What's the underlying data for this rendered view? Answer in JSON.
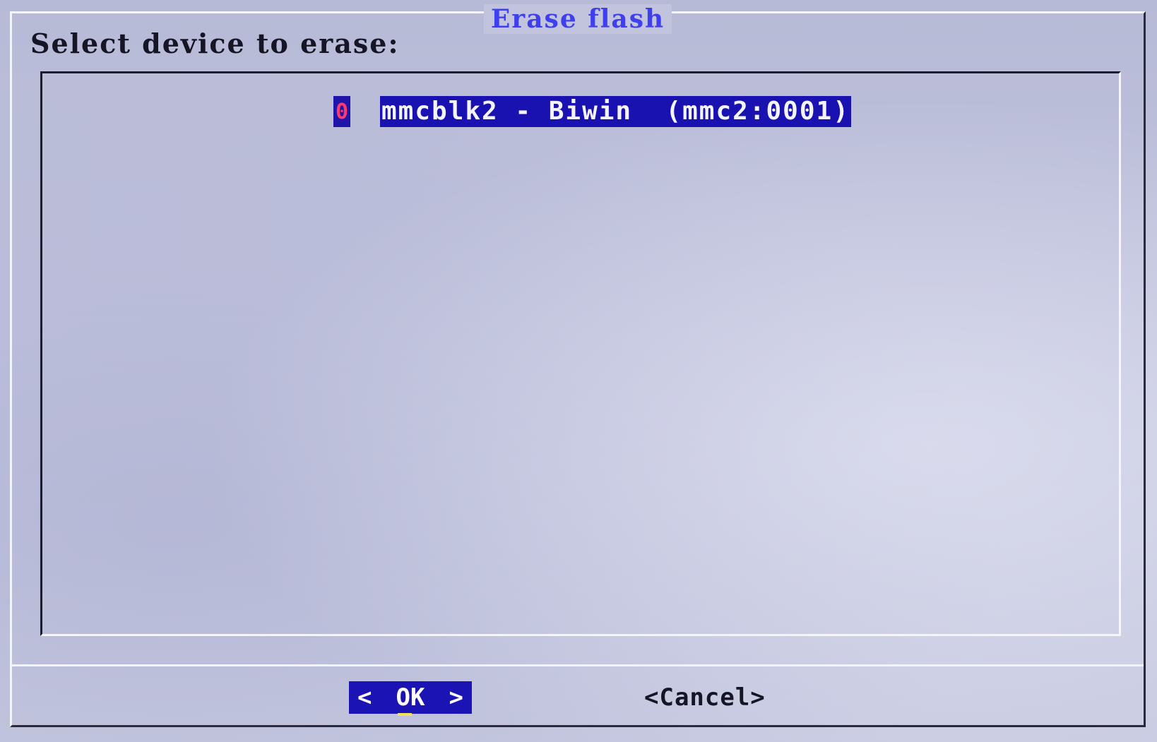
{
  "dialog": {
    "title": "Erase flash",
    "prompt": "Select device to erase:"
  },
  "list": {
    "items": [
      {
        "marker": "0",
        "label": "mmcblk2 - Biwin  (mmc2:0001)",
        "selected": true
      }
    ]
  },
  "buttons": {
    "ok": {
      "left_bracket": "<",
      "label": "OK",
      "right_bracket": ">"
    },
    "cancel": {
      "label": "<Cancel>"
    }
  },
  "colors": {
    "title": "#3f3ff0",
    "highlight_bg": "#1a12b0",
    "marker": "#ff3a6e",
    "background": "#c2c4de"
  }
}
